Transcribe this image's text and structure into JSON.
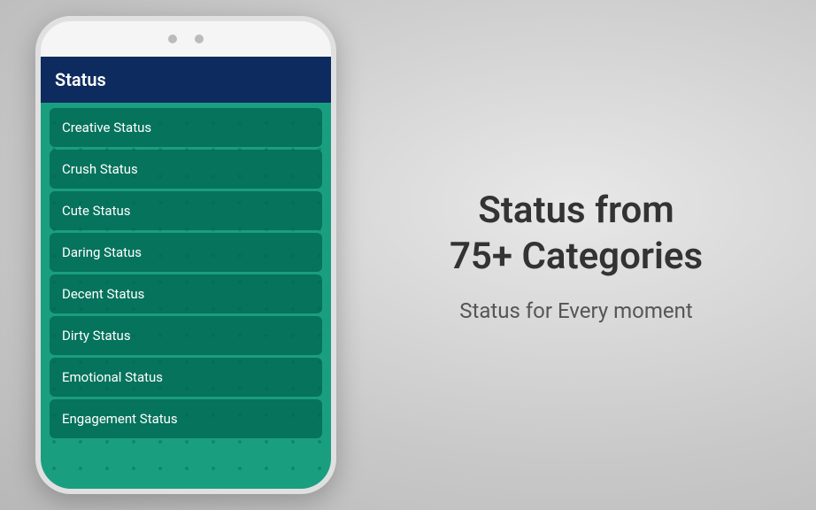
{
  "phone": {
    "camera_dots": [
      "dot1",
      "dot2"
    ],
    "header": {
      "title": "Status"
    },
    "list_items": [
      {
        "id": "creative",
        "label": "Creative Status"
      },
      {
        "id": "crush",
        "label": "Crush Status"
      },
      {
        "id": "cute",
        "label": "Cute Status"
      },
      {
        "id": "daring",
        "label": "Daring Status"
      },
      {
        "id": "decent",
        "label": "Decent Status"
      },
      {
        "id": "dirty",
        "label": "Dirty Status"
      },
      {
        "id": "emotional",
        "label": "Emotional Status"
      },
      {
        "id": "engagement",
        "label": "Engagement Status"
      }
    ]
  },
  "right_panel": {
    "headline": "Status from\n75+ Categories",
    "subheadline": "Status for Every moment"
  }
}
